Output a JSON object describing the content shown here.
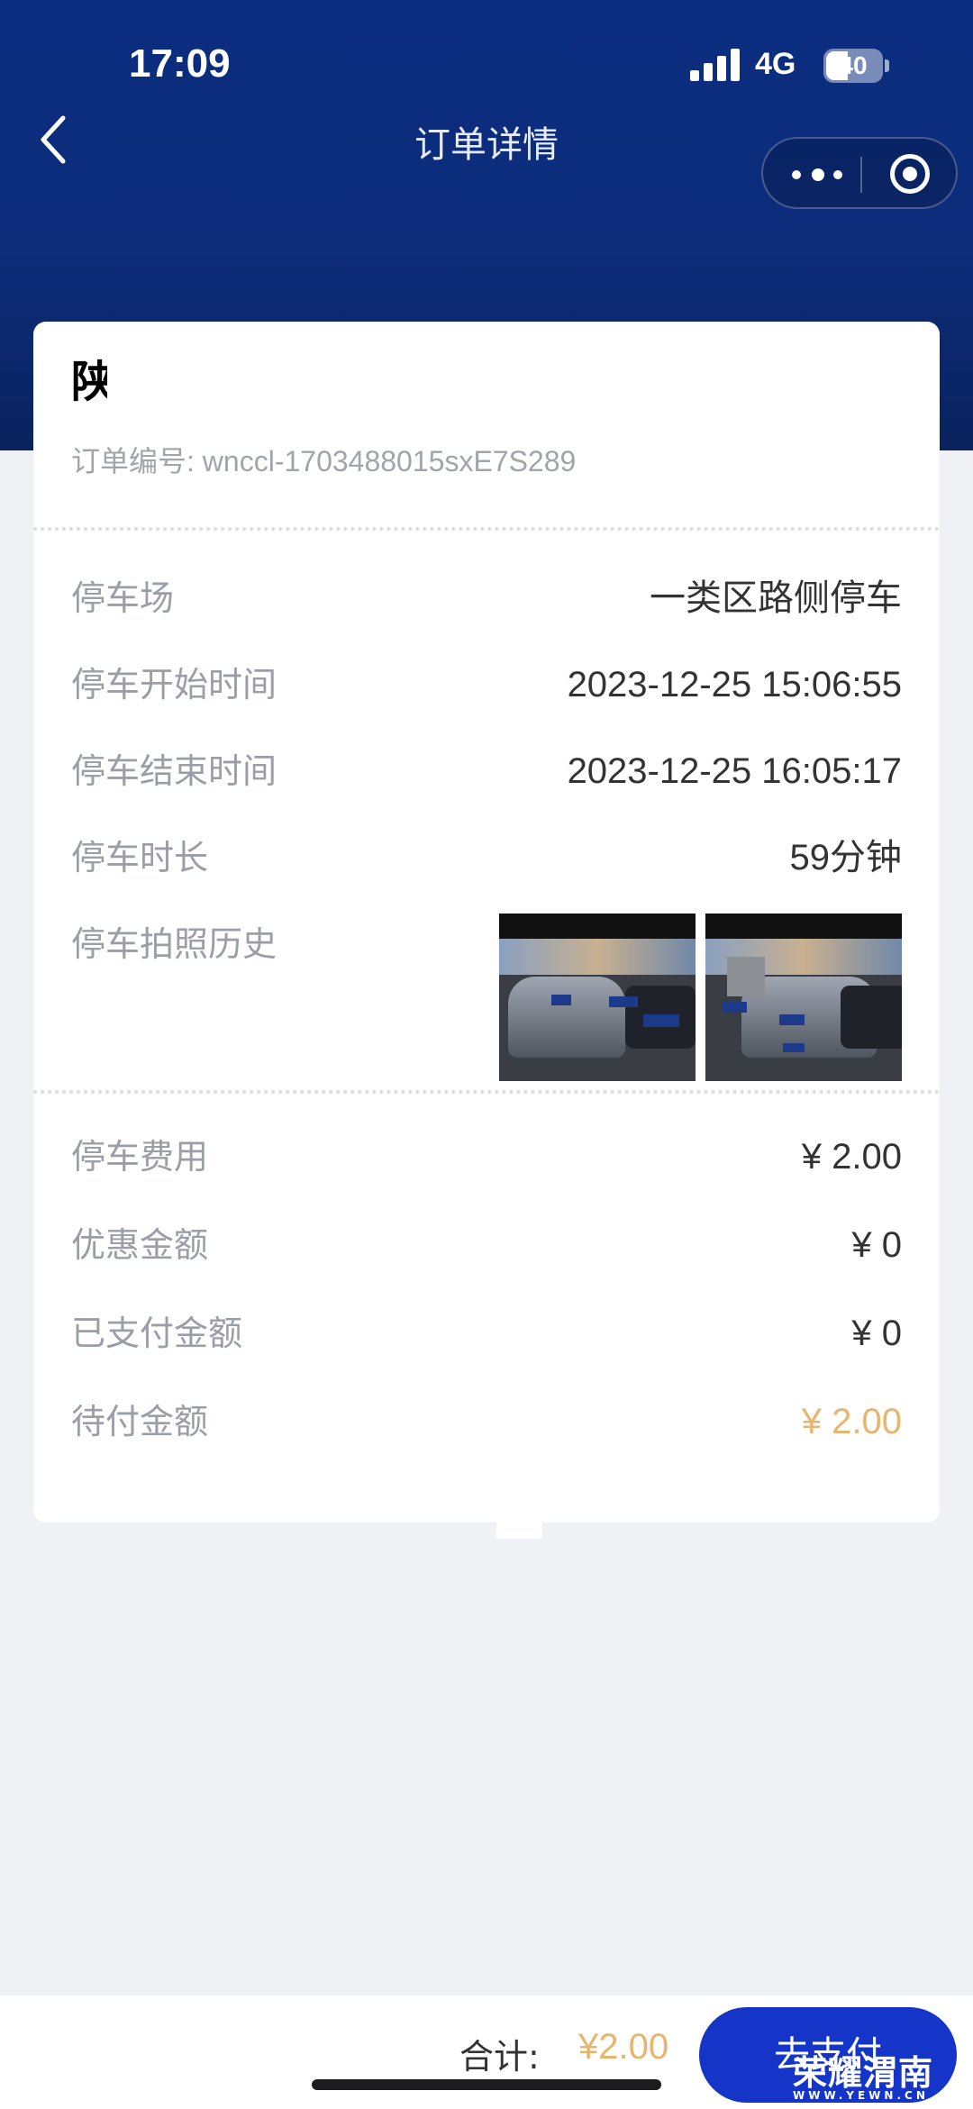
{
  "status_bar": {
    "time": "17:09",
    "network": "4G",
    "battery": "40",
    "battery_level": 0.4
  },
  "nav": {
    "title": "订单详情",
    "back_icon": "chevron-left-icon",
    "more_icon": "more-dots-icon",
    "close_icon": "target-circle-icon"
  },
  "order": {
    "plate_partial": "陕",
    "order_no_label": "订单编号: ",
    "order_no": "wnccl-1703488015sxE7S289"
  },
  "details": [
    {
      "label": "停车场",
      "value": "一类区路侧停车"
    },
    {
      "label": "停车开始时间",
      "value": "2023-12-25 15:06:55"
    },
    {
      "label": "停车结束时间",
      "value": "2023-12-25 16:05:17"
    },
    {
      "label": "停车时长",
      "value": "59分钟"
    }
  ],
  "photos": {
    "label": "停车拍照历史",
    "count": 2
  },
  "fees": [
    {
      "label": "停车费用",
      "value": "¥ 2.00"
    },
    {
      "label": "优惠金额",
      "value": "¥ 0"
    },
    {
      "label": "已支付金额",
      "value": "¥ 0"
    },
    {
      "label": "待付金额",
      "value": "¥ 2.00"
    }
  ],
  "footer": {
    "total_label": "合计:",
    "total_value": "¥2.00",
    "pay_label": "去支付"
  },
  "watermark": {
    "text": "荣耀渭南",
    "sub": "WWW.YEWN.CN"
  },
  "colors": {
    "header": "#0b2d80",
    "accent_orange": "#e7b56e",
    "pay_button": "#1435c8"
  }
}
